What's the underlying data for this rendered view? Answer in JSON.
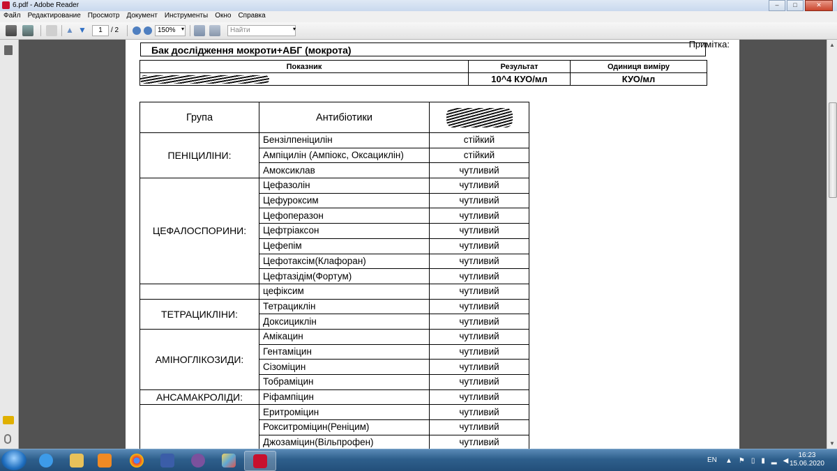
{
  "window": {
    "title": "6.pdf - Adobe Reader",
    "buttons": [
      "–",
      "□",
      "✕"
    ]
  },
  "menu": [
    "Файл",
    "Редактирование",
    "Просмотр",
    "Документ",
    "Инструменты",
    "Окно",
    "Справка"
  ],
  "toolbar": {
    "page_current": "1",
    "page_total": "/ 2",
    "zoom": "150%",
    "search_placeholder": "Найти"
  },
  "document": {
    "note": "Примітка:",
    "title": "Бак дослідження мокроти+АБГ  (мокрота)",
    "summary_headers": [
      "Показник",
      "Результат",
      "Одиниця виміру"
    ],
    "summary_result": "10^4 КУО/мл",
    "summary_unit": "КУО/мл",
    "abx_headers": [
      "Група",
      "Антибіотики"
    ],
    "groups": {
      "penicillins": "ПЕНІЦИЛІНИ:",
      "cephalosporins": "ЦЕФАЛОСПОРИНИ:",
      "tetracyclines": "ТЕТРАЦИКЛІНИ:",
      "aminoglycosides": "АМІНОГЛІКОЗИДИ:",
      "ansamacrolides": "АНСАМАКРОЛІДИ:"
    },
    "rows": [
      {
        "name": "Бензілпеніцилін",
        "result": "стійкий"
      },
      {
        "name": "Ампіцилін (Ампіокс, Оксациклін)",
        "result": "стійкий"
      },
      {
        "name": "Амоксиклав",
        "result": "чутливий"
      },
      {
        "name": "Цефазолін",
        "result": "чутливий"
      },
      {
        "name": "Цефуроксим",
        "result": "чутливий"
      },
      {
        "name": "Цефоперазон",
        "result": "чутливий"
      },
      {
        "name": "Цефтріаксон",
        "result": "чутливий"
      },
      {
        "name": "Цефепім",
        "result": "чутливий"
      },
      {
        "name": "Цефотаксім(Клафоран)",
        "result": "чутливий"
      },
      {
        "name": "Цефтазідім(Фортум)",
        "result": "чутливий"
      },
      {
        "name": "цефіксим",
        "result": "чутливий"
      },
      {
        "name": "Тетрациклін",
        "result": "чутливий"
      },
      {
        "name": "Доксициклін",
        "result": "чутливий"
      },
      {
        "name": "Амікацин",
        "result": "чутливий"
      },
      {
        "name": "Гентаміцин",
        "result": "чутливий"
      },
      {
        "name": "Сізоміцин",
        "result": "чутливий"
      },
      {
        "name": "Тобраміцин",
        "result": "чутливий"
      },
      {
        "name": "Ріфампіцин",
        "result": "чутливий"
      },
      {
        "name": "Еритроміцин",
        "result": "чутливий"
      },
      {
        "name": "Рокситроміцин(Реніцим)",
        "result": "чутливий"
      },
      {
        "name": "Джозаміцин(Вільпрофен)",
        "result": "чутливий"
      }
    ]
  },
  "taskbar": {
    "lang": "EN",
    "time": "16:23",
    "date": "15.06.2020"
  },
  "colors": {
    "taskbar": "#2e5f8c",
    "doc_background": "#525252",
    "acrobat_red": "#c8102e"
  }
}
